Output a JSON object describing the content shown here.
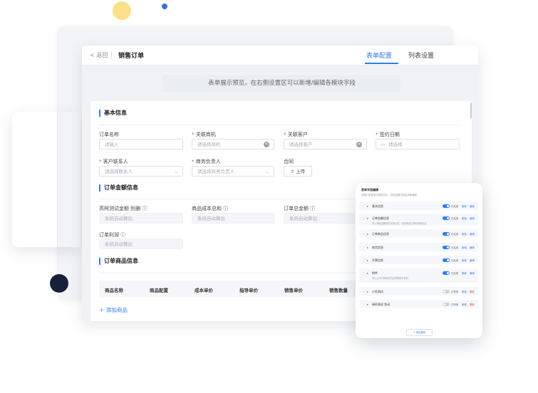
{
  "topbar": {
    "back_label": "< 返回",
    "title": "销售订单",
    "tabs": [
      {
        "label": "表单配置",
        "active": true
      },
      {
        "label": "列表设置",
        "active": false
      }
    ]
  },
  "hint": "表单展示预览，在右侧设置区可以新增/编辑各模块字段",
  "sections": {
    "basic": "基本信息",
    "amount": "订单金额信息",
    "products": "订单商品信息"
  },
  "basic_fields": {
    "order_name": {
      "label": "订单名称",
      "placeholder": "请输入"
    },
    "opportunity": {
      "label": "关联商机",
      "placeholder": "请选择商机",
      "required": true
    },
    "customer": {
      "label": "关联客户",
      "placeholder": "请选择客户",
      "required": true
    },
    "sign_date": {
      "label": "签约日期",
      "placeholder": "请选择",
      "required": true
    },
    "contact": {
      "label": "客户联系人",
      "placeholder": "请选择联系人",
      "required": true
    },
    "owner": {
      "label": "商务负责人",
      "placeholder": "请选择商务负责人",
      "required": true
    },
    "contract": {
      "label": "合同",
      "button": "上传"
    }
  },
  "amount_fields": {
    "f1": {
      "label": "高柯测试金额 别删",
      "placeholder": "系统自动算出"
    },
    "f2": {
      "label": "商品成本总和",
      "placeholder": "系统自动算出"
    },
    "f3": {
      "label": "订单总金额",
      "placeholder": "系统自动算出"
    },
    "f4": {
      "label": "订单利润",
      "placeholder": "系统自动算出"
    }
  },
  "table_headers": [
    "商品名称",
    "商品配置",
    "成本单价",
    "指导单价",
    "销售单价",
    "销售数量"
  ],
  "add_product": "添加商品",
  "panel": {
    "title": "表单字段编辑",
    "subtitle": "设置订单表单字段的显示、排序及模块的启用和编辑",
    "rows": [
      {
        "name": "基本信息",
        "desc": "",
        "toggle": "已启用",
        "on": true,
        "a1": "新增",
        "a2": "编辑"
      },
      {
        "name": "订单金额信息",
        "desc": "可以添加金额相关计算公式，自动得出订单利润等信息",
        "toggle": "已启用",
        "on": true,
        "a1": "新增",
        "a2": "编辑"
      },
      {
        "name": "订单商品信息",
        "desc": "",
        "toggle": "已启用",
        "on": true,
        "a1": "新增",
        "a2": "编辑"
      },
      {
        "name": "收货信息",
        "desc": "",
        "toggle": "已启用",
        "on": true,
        "a1": "新增",
        "a2": "编辑"
      },
      {
        "name": "开票信息",
        "desc": "",
        "toggle": "已启用",
        "on": true,
        "a1": "新增",
        "a2": "编辑"
      },
      {
        "name": "附件",
        "desc": "可以上传订单相关的合同等附件资料",
        "toggle": "已启用",
        "on": true,
        "a1": "新增",
        "a2": "编辑"
      },
      {
        "name": "小狂测试",
        "desc": "",
        "toggle": "已停用",
        "on": false,
        "a1": "新增",
        "a2": "删除"
      },
      {
        "name": "高柯测试 别动",
        "desc": "",
        "toggle": "已停用",
        "on": false,
        "a1": "新增",
        "a2": "删除"
      }
    ],
    "add_button": "+ 添加模块"
  }
}
